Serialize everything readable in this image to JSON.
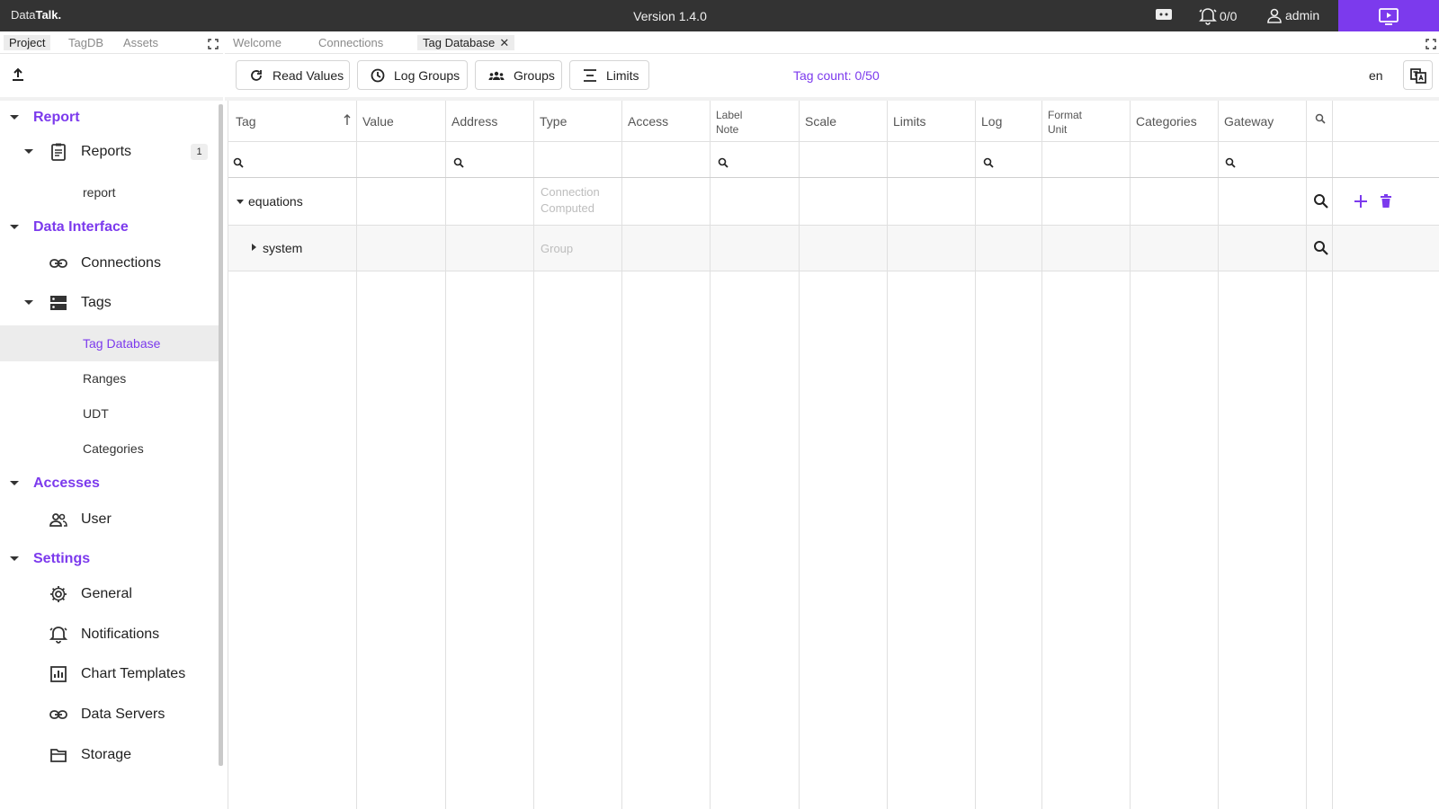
{
  "app": {
    "brand_prefix": "Data",
    "brand_suffix": "Talk.",
    "version": "Version 1.4.0",
    "alarm_count": "0/0",
    "user": "admin"
  },
  "colors": {
    "accent": "#7c3aed",
    "topbar": "#333333"
  },
  "side_tabs": [
    "Project",
    "TagDB",
    "Assets"
  ],
  "sidebar": {
    "sections": [
      {
        "label": "Report"
      },
      {
        "label": "Data Interface"
      },
      {
        "label": "Accesses"
      },
      {
        "label": "Settings"
      }
    ],
    "reports": {
      "label": "Reports",
      "badge": "1",
      "children": [
        "report"
      ]
    },
    "connections": "Connections",
    "tags": {
      "label": "Tags",
      "children": [
        "Tag Database",
        "Ranges",
        "UDT",
        "Categories"
      ]
    },
    "user": "User",
    "settings": [
      "General",
      "Notifications",
      "Chart Templates",
      "Data Servers",
      "Storage"
    ]
  },
  "main_tabs": [
    "Welcome",
    "Connections",
    "Tag Database"
  ],
  "toolbar": {
    "read_values": "Read Values",
    "log_groups": "Log Groups",
    "groups": "Groups",
    "limits": "Limits",
    "tag_count": "Tag count: 0/50",
    "language": "en"
  },
  "table": {
    "columns": {
      "tag": "Tag",
      "value": "Value",
      "address": "Address",
      "type": "Type",
      "access": "Access",
      "label": "Label",
      "note": "Note",
      "scale": "Scale",
      "limits": "Limits",
      "log": "Log",
      "format": "Format",
      "unit": "Unit",
      "categories": "Categories",
      "gateway": "Gateway"
    },
    "rows": [
      {
        "name": "equations",
        "type_line1": "Connection",
        "type_line2": "Computed"
      },
      {
        "name": "system",
        "type_line1": "Group"
      }
    ]
  }
}
